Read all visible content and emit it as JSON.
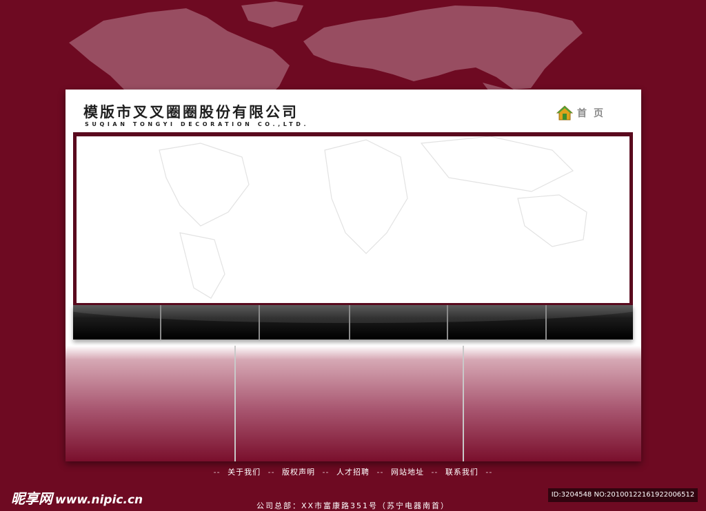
{
  "company": {
    "name_cn": "模版市叉叉圈圈股份有限公司",
    "name_en": "SUQIAN TONGYI DECORATION CO.,LTD."
  },
  "header": {
    "home_label": "首页",
    "home_icon": "home-icon"
  },
  "nav": {
    "items": [
      "",
      "",
      "",
      "",
      "",
      ""
    ]
  },
  "footer": {
    "links": [
      "关于我们",
      "版权声明",
      "人才招聘",
      "网站地址",
      "联系我们"
    ],
    "separator": "--",
    "address": "公司总部：XX市富康路351号（苏宁电器南首）"
  },
  "watermark": {
    "brand": "昵享网",
    "url": "www.nipic.cn",
    "id_text": "ID:3204548 NO:20100122161922006512"
  },
  "colors": {
    "background": "#6e0a22",
    "banner_border": "#5a0a1e",
    "navbar": "#000000",
    "content_gradient_bottom": "#7a0f2c"
  }
}
